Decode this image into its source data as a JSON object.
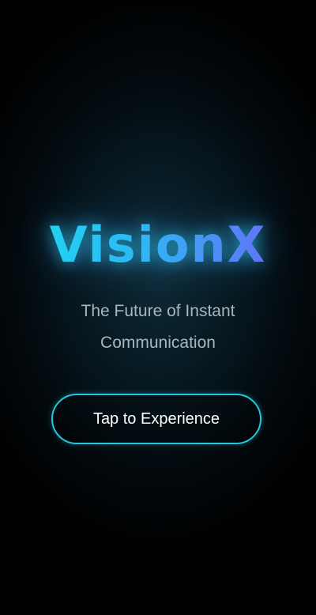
{
  "app": {
    "logo_text": "VisionX",
    "tagline_line1": "The Future of Instant",
    "tagline_line2": "Communication",
    "cta_label": "Tap to Experience"
  },
  "colors": {
    "accent_cyan": "#22c8e0",
    "logo_gradient_start": "#19e0f0",
    "logo_gradient_end": "#7a5cf4",
    "background": "#000000",
    "tagline_text": "#a9b6bf"
  }
}
